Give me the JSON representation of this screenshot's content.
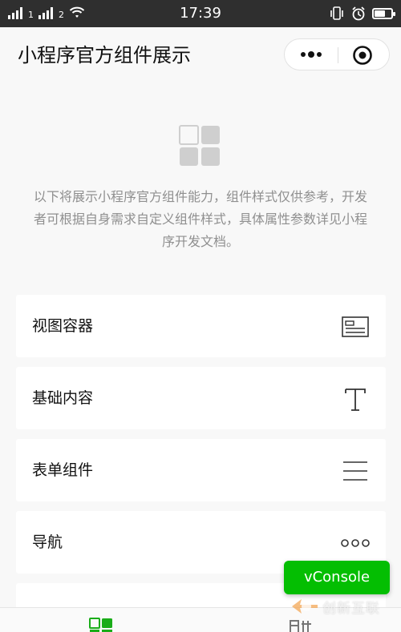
{
  "status_bar": {
    "time": "17:39",
    "sim1": "1",
    "sim2": "2"
  },
  "nav": {
    "title": "小程序官方组件展示",
    "more_icon": "more-dots-icon",
    "close_icon": "target-close-icon"
  },
  "intro": {
    "logo_icon": "components-grid-icon",
    "text": "以下将展示小程序官方组件能力，组件样式仅供参考，开发者可根据自身需求自定义组件样式，具体属性参数详见小程序开发文档。"
  },
  "list": [
    {
      "label": "视图容器",
      "icon": "view-container-icon"
    },
    {
      "label": "基础内容",
      "icon": "text-t-icon"
    },
    {
      "label": "表单组件",
      "icon": "list-lines-icon"
    },
    {
      "label": "导航",
      "icon": "three-circles-icon"
    }
  ],
  "vconsole": {
    "label": "vConsole"
  },
  "tabs": [
    {
      "icon": "components-tab-icon",
      "active_color": "#1aad19"
    },
    {
      "icon": "api-tab-icon"
    }
  ],
  "watermark": {
    "text": "创新互联"
  },
  "colors": {
    "accent": "#1aad19",
    "vconsole_bg": "#04be02",
    "status_bar_bg": "#2f2f2f",
    "page_bg": "#f8f8f8"
  }
}
